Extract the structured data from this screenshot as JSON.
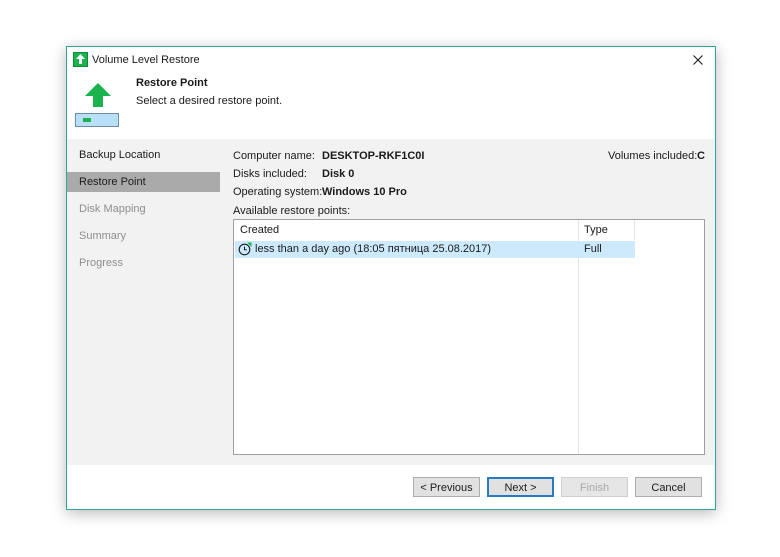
{
  "window": {
    "title": "Volume Level Restore"
  },
  "header": {
    "title": "Restore Point",
    "subtitle": "Select a desired restore point."
  },
  "sidebar": {
    "items": [
      {
        "label": "Backup Location"
      },
      {
        "label": "Restore Point"
      },
      {
        "label": "Disk Mapping"
      },
      {
        "label": "Summary"
      },
      {
        "label": "Progress"
      }
    ]
  },
  "info": {
    "computer_label": "Computer name:",
    "computer_value": "DESKTOP-RKF1C0I",
    "disks_label": "Disks included:",
    "disks_value": "Disk 0",
    "os_label": "Operating system:",
    "os_value": "Windows 10 Pro",
    "volumes_label": "Volumes included:",
    "volumes_value": "C",
    "available_label": "Available restore points:"
  },
  "grid": {
    "columns": {
      "created": "Created",
      "type": "Type"
    },
    "rows": [
      {
        "created": "less than a day ago (18:05 пятница 25.08.2017)",
        "type": "Full"
      }
    ]
  },
  "buttons": {
    "previous": "< Previous",
    "next": "Next >",
    "finish": "Finish",
    "cancel": "Cancel"
  },
  "colors": {
    "accent_border": "#2aa7a0",
    "selection": "#cdeafd",
    "brand_green": "#1bb34d"
  },
  "icons": [
    "veeam-app-icon",
    "close-icon",
    "upload-arrow-icon",
    "disk-icon",
    "restore-point-clock-icon"
  ]
}
